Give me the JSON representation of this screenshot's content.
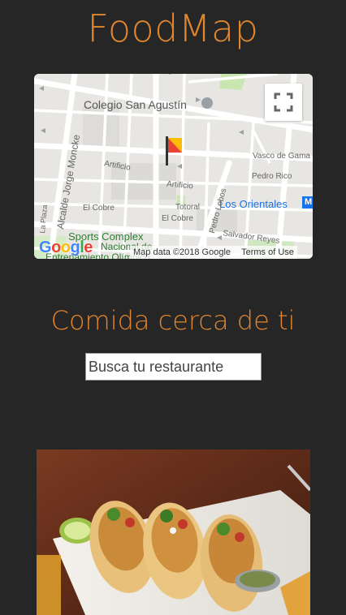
{
  "app": {
    "title": "FoodMap"
  },
  "map": {
    "labels": {
      "colegio": "Colegio San Agustín",
      "alcalde": "Alcalde Jorge Moncke",
      "artificio1": "Artificio",
      "artificio2": "Artificio",
      "vasco": "Vasco de Gama",
      "pedro_rico": "Pedro Rico",
      "los_orientales": "Los Orientales",
      "el_cobre1": "El Cobre",
      "el_cobre2": "El Cobre",
      "totoral": "Totoral",
      "pedro_lobos": "Pedro Lobos",
      "sports1": "Sports Complex",
      "sports2": "Nacional de",
      "sports3": "Entrenamiento Olímpico",
      "salvador": "Salvador Reyes",
      "la_plaza": "La Plaza",
      "ra": "Ra"
    },
    "attribution": "Map data ©2018 Google",
    "terms": "Terms of Use",
    "logo_letters": [
      "G",
      "o",
      "o",
      "g",
      "l",
      "e"
    ],
    "logo_colors": [
      "#4285F4",
      "#EA4335",
      "#FBBC05",
      "#4285F4",
      "#34A853",
      "#EA4335"
    ],
    "icons": {
      "fullscreen": "fullscreen-icon",
      "marker": "flag-marker-icon",
      "metro": "metro-icon"
    },
    "metro_letter": "M"
  },
  "section": {
    "title": "Comida cerca de ti"
  },
  "search": {
    "placeholder": "Busca tu restaurante",
    "value": ""
  },
  "colors": {
    "accent": "#e0862f",
    "background": "#262626"
  }
}
